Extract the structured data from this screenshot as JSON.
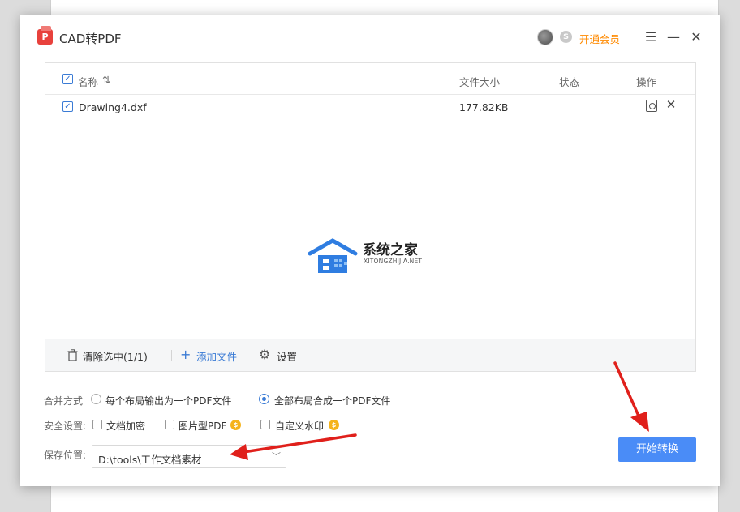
{
  "titlebar": {
    "app_title": "CAD转PDF",
    "vip_label": "开通会员"
  },
  "table": {
    "headers": {
      "name": "名称",
      "sort_glyph": "⇅",
      "size": "文件大小",
      "status": "状态",
      "action": "操作"
    },
    "rows": [
      {
        "name": "Drawing4.dxf",
        "size": "177.82KB",
        "status": "",
        "checked": true
      }
    ]
  },
  "watermark": {
    "title": "系统之家",
    "subtitle": "XITONGZHIJIA.NET"
  },
  "footer": {
    "clear_label": "清除选中(1/1)",
    "add_label": "添加文件",
    "settings_label": "设置"
  },
  "merge": {
    "label": "合并方式",
    "option_each": "每个布局输出为一个PDF文件",
    "option_all": "全部布局合成一个PDF文件",
    "selected": "option_all"
  },
  "security": {
    "label": "安全设置:",
    "encrypt": "文档加密",
    "image_pdf": "图片型PDF",
    "watermark": "自定义水印"
  },
  "save": {
    "label": "保存位置:",
    "path": "D:\\tools\\工作文档素材"
  },
  "actions": {
    "start_label": "开始转换"
  },
  "colors": {
    "accent": "#4a8cf7",
    "vip": "#ff8a00",
    "arrow": "#e0201b"
  },
  "icons": {
    "preview": "preview-icon",
    "remove": "close-icon",
    "trash": "trash-icon",
    "add": "plus-icon",
    "gear": "gear-icon",
    "coin": "coin-icon"
  }
}
